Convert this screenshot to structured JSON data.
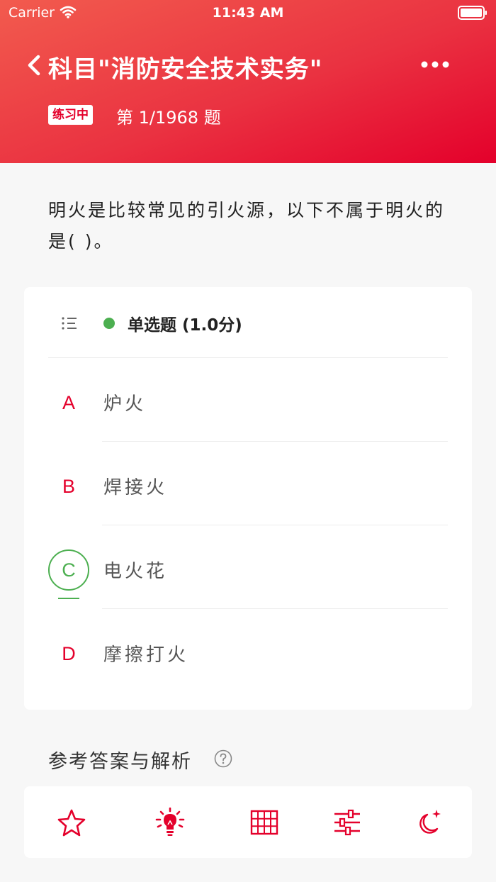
{
  "status_bar": {
    "carrier": "Carrier",
    "time": "11:43 AM"
  },
  "nav": {
    "title": "科目\"消防安全技术实务\""
  },
  "progress": {
    "mode": "练习中",
    "text": "第 1/1968 题"
  },
  "question": {
    "text": "明火是比较常见的引火源，以下不属于明火的是(    )。"
  },
  "card": {
    "type_label": "单选题 (1.0分)",
    "options": [
      {
        "letter": "A",
        "text": "炉火",
        "selected": false
      },
      {
        "letter": "B",
        "text": "焊接火",
        "selected": false
      },
      {
        "letter": "C",
        "text": "电火花",
        "selected": true
      },
      {
        "letter": "D",
        "text": "摩擦打火",
        "selected": false
      }
    ]
  },
  "explanation": {
    "title": "参考答案与解析"
  },
  "toolbar": {
    "items": [
      "star-icon",
      "lightbulb-icon",
      "grid-icon",
      "sliders-icon",
      "moon-icon"
    ]
  },
  "colors": {
    "brand": "#e4002b",
    "correct": "#4caf50",
    "header_start": "#f25b4e",
    "header_end": "#e4002b"
  }
}
